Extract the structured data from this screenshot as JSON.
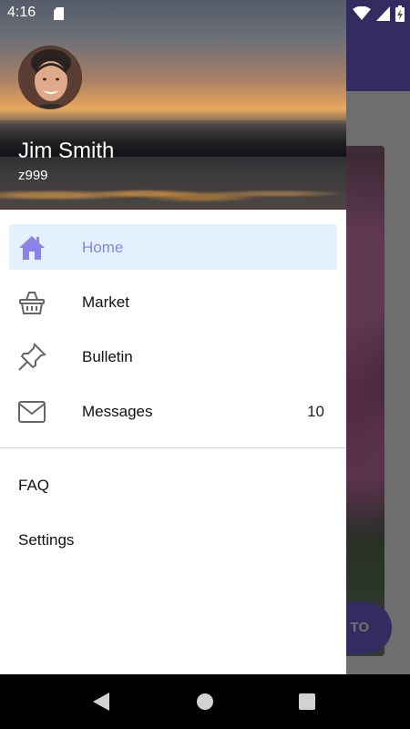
{
  "status": {
    "time": "4:16"
  },
  "drawer": {
    "user_name": "Jim Smith",
    "user_id": "z999",
    "items": [
      {
        "label": "Home",
        "icon": "home-icon",
        "active": true
      },
      {
        "label": "Market",
        "icon": "basket-icon"
      },
      {
        "label": "Bulletin",
        "icon": "pin-icon"
      },
      {
        "label": "Messages",
        "icon": "mail-icon",
        "count": "10"
      }
    ],
    "secondary": [
      {
        "label": "FAQ"
      },
      {
        "label": "Settings"
      }
    ]
  },
  "background": {
    "fab_label": "TO"
  },
  "colors": {
    "accent": "#8c82e8",
    "active_bg": "#e3f0fd",
    "app_bar": "#6f63d8"
  }
}
